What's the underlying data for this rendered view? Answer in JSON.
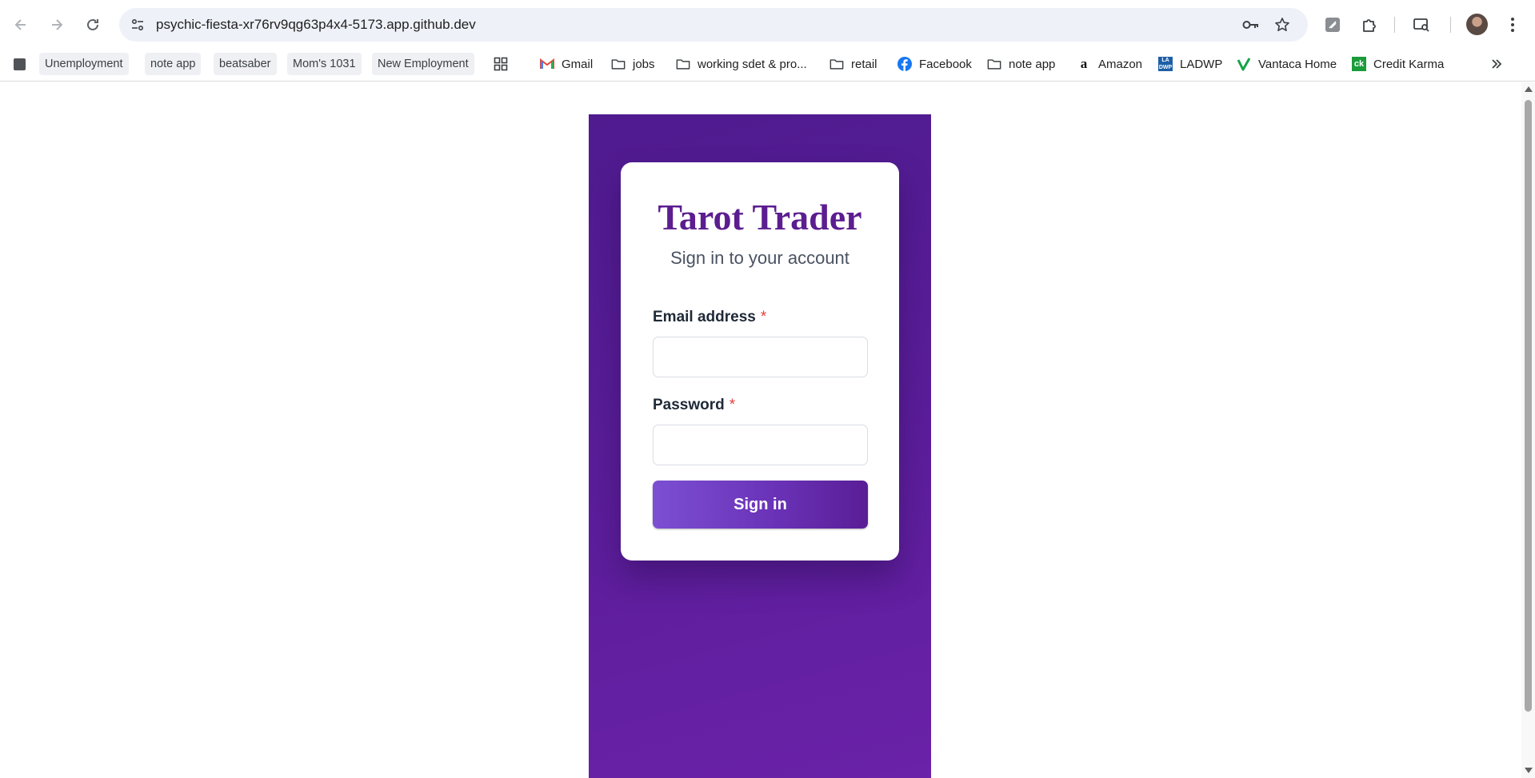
{
  "browser": {
    "url": "psychic-fiesta-xr76rv9qg63p4x4-5173.app.github.dev"
  },
  "bookmarks": [
    {
      "label": "Unemployment",
      "icon": "bookmark-chip"
    },
    {
      "label": "note app",
      "icon": "bookmark-chip"
    },
    {
      "label": "beatsaber",
      "icon": "bookmark-chip"
    },
    {
      "label": "Mom's 1031",
      "icon": "bookmark-chip"
    },
    {
      "label": "New Employment",
      "icon": "bookmark-chip"
    },
    {
      "label": "Gmail",
      "icon": "gmail-icon"
    },
    {
      "label": "jobs",
      "icon": "folder-icon"
    },
    {
      "label": "working sdet & pro...",
      "icon": "folder-icon"
    },
    {
      "label": "retail",
      "icon": "folder-icon"
    },
    {
      "label": "Facebook",
      "icon": "facebook-icon"
    },
    {
      "label": "note app",
      "icon": "folder-icon"
    },
    {
      "label": "Amazon",
      "icon": "amazon-icon"
    },
    {
      "label": "LADWP",
      "icon": "ladwp-icon"
    },
    {
      "label": "Vantaca Home",
      "icon": "vantaca-icon"
    },
    {
      "label": "Credit Karma",
      "icon": "credit-karma-icon"
    }
  ],
  "app": {
    "title": "Tarot Trader",
    "subtitle": "Sign in to your account",
    "email_label": "Email address",
    "email_value": "",
    "password_label": "Password",
    "password_value": "",
    "required_marker": "*",
    "submit_label": "Sign in"
  },
  "colors": {
    "brand_purple": "#5b1d8f",
    "panel_purple": "#5b1d9a",
    "required_red": "#e53e3e"
  }
}
